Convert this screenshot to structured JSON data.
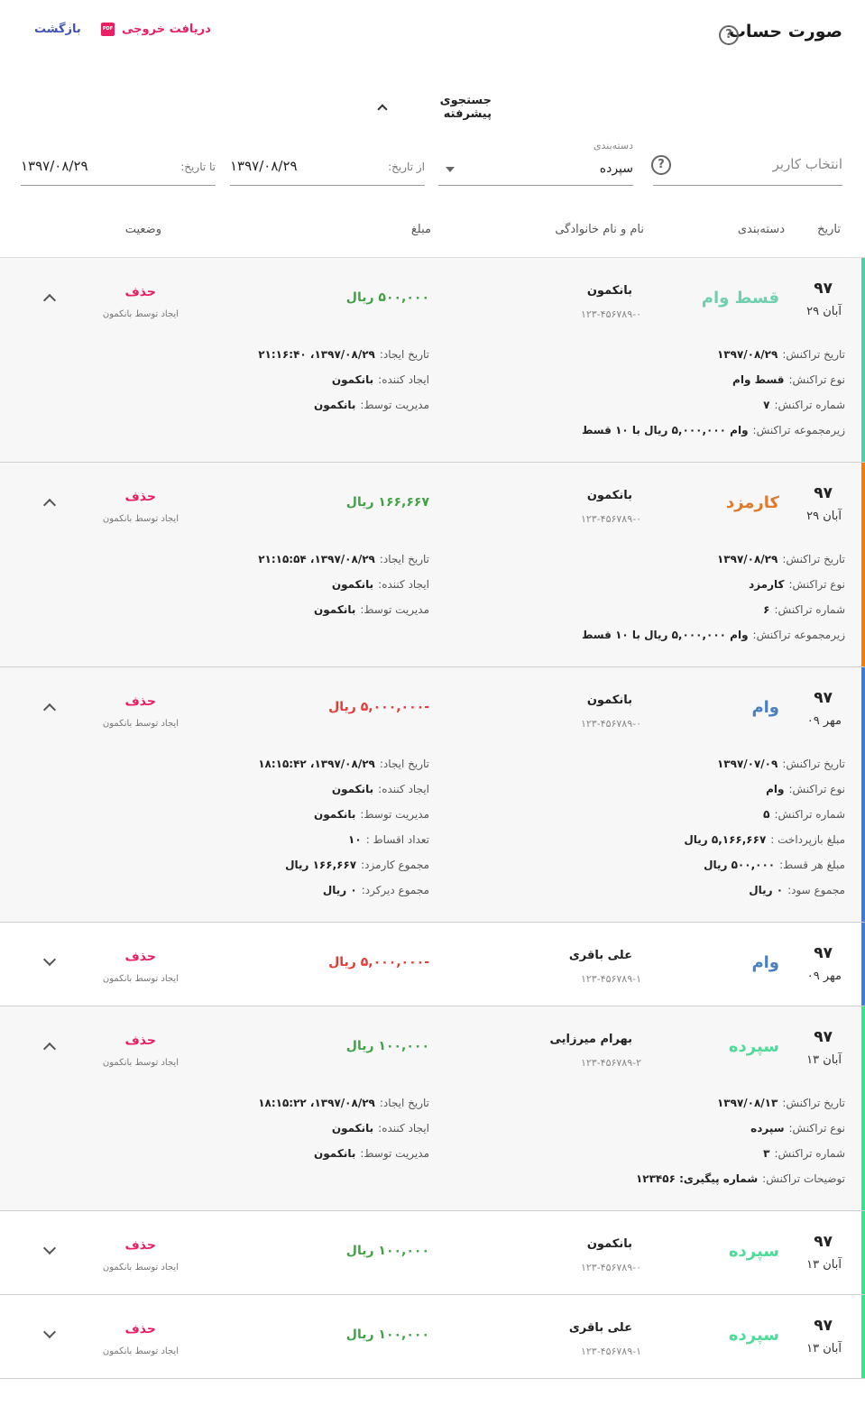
{
  "header": {
    "title": "صورت حساب",
    "back_label": "بازگشت",
    "export_label": "دریافت خروجی",
    "export_icon_text": "PDF"
  },
  "search": {
    "toggle_label": "جستجوی پیشرفته",
    "user_placeholder": "انتخاب کاربر",
    "category_label": "دسته‌بندی",
    "category_value": "سپرده",
    "from_label": "از تاریخ:",
    "from_value": "۱۳۹۷/۰۸/۲۹",
    "to_label": "تا تاریخ:",
    "to_value": "۱۳۹۷/۰۸/۲۹"
  },
  "table": {
    "columns": {
      "date": "تاریخ",
      "category": "دسته‌بندی",
      "name": "نام و نام خانوادگی",
      "amount": "مبلغ",
      "status": "وضعیت"
    },
    "rows": [
      {
        "year": "۹۷",
        "day": "آبان ۲۹",
        "category": "قسط وام",
        "category_color": "#6fcfae",
        "stripe_color": "#4dd0a8",
        "name": "بانکمون",
        "account": "۱۲۳-۴۵۶۷۸۹-۰",
        "amount": "۵۰۰,۰۰۰ ریال",
        "amount_type": "pos",
        "delete_label": "حذف",
        "creator_label": "ایجاد توسط بانکمون",
        "expanded": true,
        "details_right": [
          {
            "k": "تاریخ تراکنش:",
            "v": "۱۳۹۷/۰۸/۲۹"
          },
          {
            "k": "نوع تراکنش:",
            "v": "قسط وام"
          },
          {
            "k": "شماره تراکنش:",
            "v": "۷"
          },
          {
            "k": "زیرمجموعه تراکنش:",
            "v": "وام ۵,۰۰۰,۰۰۰ ریال با ۱۰ قسط"
          }
        ],
        "details_left": [
          {
            "k": "تاریخ ایجاد:",
            "v": "۱۳۹۷/۰۸/۲۹، ۲۱:۱۶:۴۰"
          },
          {
            "k": "ایجاد کننده:",
            "v": "بانکمون"
          },
          {
            "k": "مدیریت توسط:",
            "v": "بانکمون"
          }
        ]
      },
      {
        "year": "۹۷",
        "day": "آبان ۲۹",
        "category": "کارمزد",
        "category_color": "#e07a2e",
        "stripe_color": "#f57c00",
        "name": "بانکمون",
        "account": "۱۲۳-۴۵۶۷۸۹-۰",
        "amount": "۱۶۶,۶۶۷ ریال",
        "amount_type": "pos",
        "delete_label": "حذف",
        "creator_label": "ایجاد توسط بانکمون",
        "expanded": true,
        "details_right": [
          {
            "k": "تاریخ تراکنش:",
            "v": "۱۳۹۷/۰۸/۲۹"
          },
          {
            "k": "نوع تراکنش:",
            "v": "کارمزد"
          },
          {
            "k": "شماره تراکنش:",
            "v": "۶"
          },
          {
            "k": "زیرمجموعه تراکنش:",
            "v": "وام ۵,۰۰۰,۰۰۰ ریال با ۱۰ قسط"
          }
        ],
        "details_left": [
          {
            "k": "تاریخ ایجاد:",
            "v": "۱۳۹۷/۰۸/۲۹، ۲۱:۱۵:۵۴"
          },
          {
            "k": "ایجاد کننده:",
            "v": "بانکمون"
          },
          {
            "k": "مدیریت توسط:",
            "v": "بانکمون"
          }
        ]
      },
      {
        "year": "۹۷",
        "day": "مهر ۰۹",
        "category": "وام",
        "category_color": "#4a7fc1",
        "stripe_color": "#3b7dd8",
        "name": "بانکمون",
        "account": "۱۲۳-۴۵۶۷۸۹-۰",
        "amount": "-۵,۰۰۰,۰۰۰ ریال",
        "amount_type": "neg",
        "delete_label": "حذف",
        "creator_label": "ایجاد توسط بانکمون",
        "expanded": true,
        "details_right": [
          {
            "k": "تاریخ تراکنش:",
            "v": "۱۳۹۷/۰۷/۰۹"
          },
          {
            "k": "نوع تراکنش:",
            "v": "وام"
          },
          {
            "k": "شماره تراکنش:",
            "v": "۵"
          },
          {
            "k": "مبلغ بازپرداخت :",
            "v": "۵,۱۶۶,۶۶۷ ریال"
          },
          {
            "k": "مبلغ هر قسط:",
            "v": "۵۰۰,۰۰۰ ریال"
          },
          {
            "k": "مجموع سود:",
            "v": "۰ ریال"
          }
        ],
        "details_left": [
          {
            "k": "تاریخ ایجاد:",
            "v": "۱۳۹۷/۰۸/۲۹، ۱۸:۱۵:۴۲"
          },
          {
            "k": "ایجاد کننده:",
            "v": "بانکمون"
          },
          {
            "k": "مدیریت توسط:",
            "v": "بانکمون"
          },
          {
            "k": "تعداد اقساط :",
            "v": "۱۰"
          },
          {
            "k": "مجموع کارمزد:",
            "v": "۱۶۶,۶۶۷ ریال"
          },
          {
            "k": "مجموع دیرکرد:",
            "v": "۰ ریال"
          }
        ]
      },
      {
        "year": "۹۷",
        "day": "مهر ۰۹",
        "category": "وام",
        "category_color": "#4a7fc1",
        "stripe_color": "#3b7dd8",
        "name": "علی باقری",
        "account": "۱۲۳-۴۵۶۷۸۹-۱",
        "amount": "-۵,۰۰۰,۰۰۰ ریال",
        "amount_type": "neg",
        "delete_label": "حذف",
        "creator_label": "ایجاد توسط بانکمون",
        "expanded": false,
        "details_right": [],
        "details_left": []
      },
      {
        "year": "۹۷",
        "day": "آبان ۱۳",
        "category": "سپرده",
        "category_color": "#4fdc9a",
        "stripe_color": "#2ee88a",
        "name": "بهرام میرزایی",
        "account": "۱۲۳-۴۵۶۷۸۹-۲",
        "amount": "۱۰۰,۰۰۰ ریال",
        "amount_type": "pos",
        "delete_label": "حذف",
        "creator_label": "ایجاد توسط بانکمون",
        "expanded": true,
        "details_right": [
          {
            "k": "تاریخ تراکنش:",
            "v": "۱۳۹۷/۰۸/۱۳"
          },
          {
            "k": "نوع تراکنش:",
            "v": "سپرده"
          },
          {
            "k": "شماره تراکنش:",
            "v": "۳"
          },
          {
            "k": "توضیحات تراکنش:",
            "v": "شماره پیگیری: ۱۲۳۴۵۶"
          }
        ],
        "details_left": [
          {
            "k": "تاریخ ایجاد:",
            "v": "۱۳۹۷/۰۸/۲۹، ۱۸:۱۵:۲۲"
          },
          {
            "k": "ایجاد کننده:",
            "v": "بانکمون"
          },
          {
            "k": "مدیریت توسط:",
            "v": "بانکمون"
          }
        ]
      },
      {
        "year": "۹۷",
        "day": "آبان ۱۳",
        "category": "سپرده",
        "category_color": "#4fdc9a",
        "stripe_color": "#2ee88a",
        "name": "بانکمون",
        "account": "۱۲۳-۴۵۶۷۸۹-۰",
        "amount": "۱۰۰,۰۰۰ ریال",
        "amount_type": "pos",
        "delete_label": "حذف",
        "creator_label": "ایجاد توسط بانکمون",
        "expanded": false,
        "details_right": [],
        "details_left": []
      },
      {
        "year": "۹۷",
        "day": "آبان ۱۳",
        "category": "سپرده",
        "category_color": "#4fdc9a",
        "stripe_color": "#2ee88a",
        "name": "علی باقری",
        "account": "۱۲۳-۴۵۶۷۸۹-۱",
        "amount": "۱۰۰,۰۰۰ ریال",
        "amount_type": "pos",
        "delete_label": "حذف",
        "creator_label": "ایجاد توسط بانکمون",
        "expanded": false,
        "details_right": [],
        "details_left": []
      }
    ]
  }
}
